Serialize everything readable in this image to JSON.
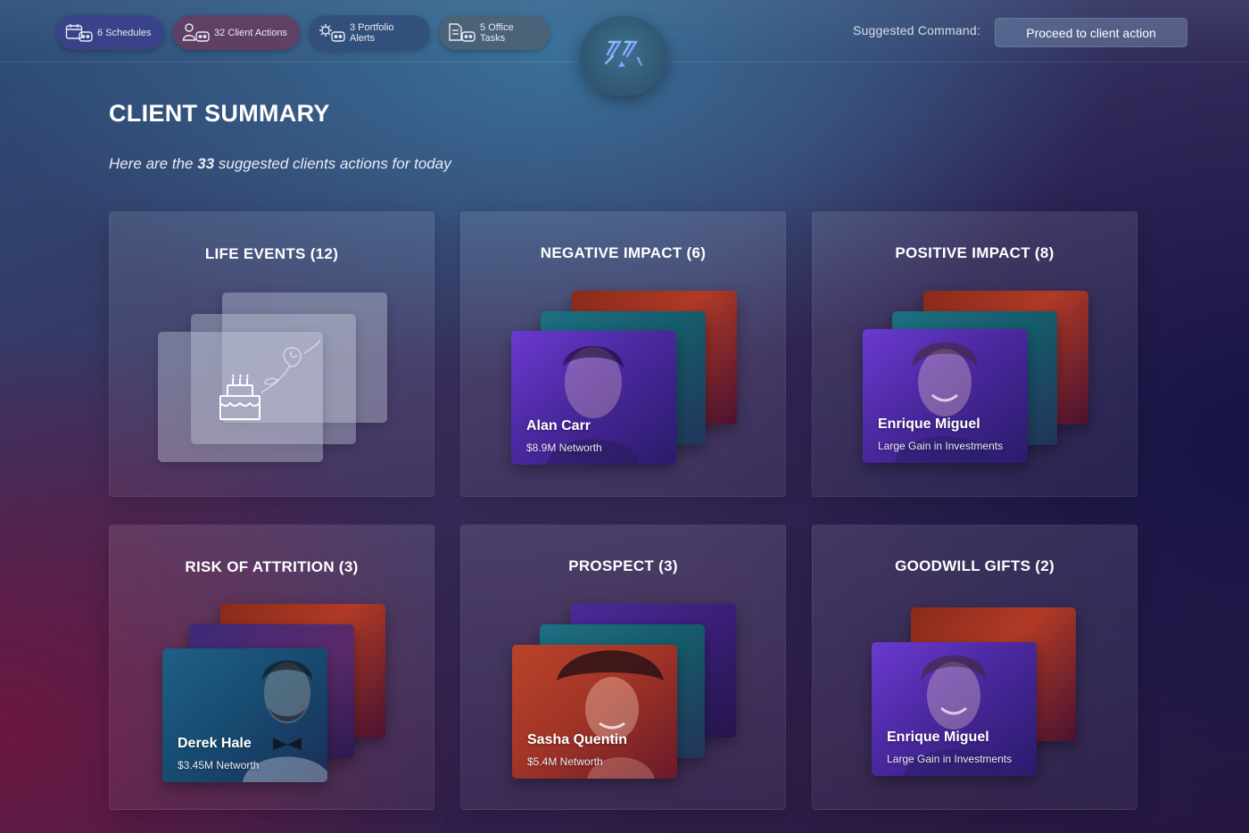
{
  "topbar": {
    "pills": [
      {
        "label": "6 Schedules",
        "icon": "calendar-robot-icon"
      },
      {
        "label": "32 Client Actions",
        "icon": "people-robot-icon"
      },
      {
        "label": "3 Portfolio Alerts",
        "icon": "gear-robot-icon"
      },
      {
        "label": "5 Office Tasks",
        "icon": "document-robot-icon"
      }
    ],
    "logo": "assistant-logo-icon",
    "suggest_label": "Suggested  Command:",
    "command_button": "Proceed to client action"
  },
  "main": {
    "title": "CLIENT SUMMARY",
    "subtitle_pre": "Here are the ",
    "subtitle_count": "33",
    "subtitle_post": " suggested clients actions for today"
  },
  "cards": {
    "life_events": {
      "title": "LIFE EVENTS (12)",
      "icons": [
        "birthday-cake-icon",
        "rose-icon"
      ]
    },
    "negative_impact": {
      "title": "NEGATIVE IMPACT (6)",
      "name": "Alan Carr",
      "detail": "$8.9M Networth"
    },
    "positive_impact": {
      "title": "POSITIVE IMPACT (8)",
      "name": "Enrique Miguel",
      "detail": "Large Gain in Investments"
    },
    "risk_of_attrition": {
      "title": "RISK OF ATTRITION (3)",
      "name": "Derek Hale",
      "detail": "$3.45M Networth"
    },
    "prospect": {
      "title": "PROSPECT (3)",
      "name": "Sasha Quentin",
      "detail": "$5.4M Networth"
    },
    "goodwill_gifts": {
      "title": "GOODWILL GIFTS (2)",
      "name": "Enrique Miguel",
      "detail": "Large Gain in Investments"
    }
  },
  "colors": {
    "accent": "#7b6cff",
    "logo_gradient": [
      "#7fd6ff",
      "#8b7cff"
    ]
  }
}
